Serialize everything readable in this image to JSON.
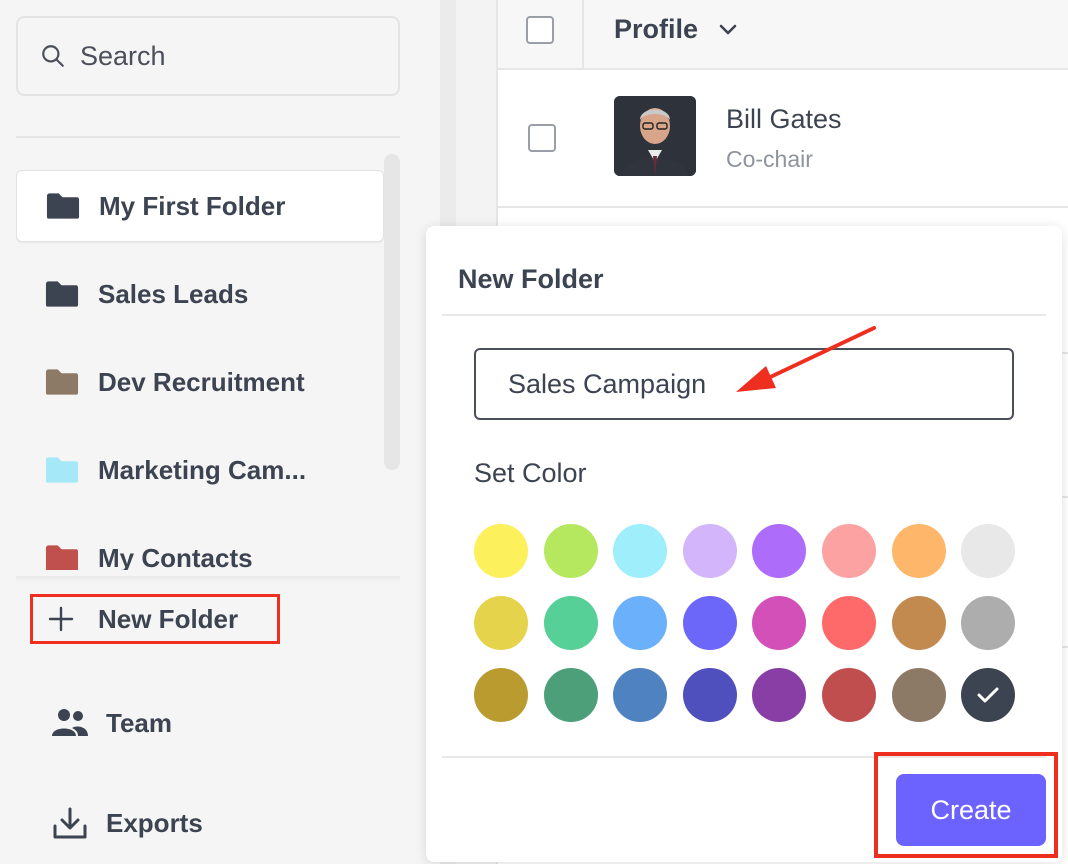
{
  "sidebar": {
    "search": {
      "placeholder": "Search",
      "icon": "search-icon"
    },
    "folders": [
      {
        "label": "My First Folder",
        "color": "#3d4451",
        "selected": true
      },
      {
        "label": "Sales Leads",
        "color": "#3d4451",
        "selected": false
      },
      {
        "label": "Dev Recruitment",
        "color": "#8c7a66",
        "selected": false
      },
      {
        "label": "Marketing Cam...",
        "color": "#a5e8f7",
        "selected": false
      },
      {
        "label": "My Contacts",
        "color": "#c0504d",
        "selected": false
      }
    ],
    "new_folder_label": "New Folder",
    "nav": [
      {
        "label": "Team",
        "icon": "team-icon"
      },
      {
        "label": "Exports",
        "icon": "download-icon"
      }
    ]
  },
  "table": {
    "header": {
      "column": "Profile"
    },
    "rows": [
      {
        "name": "Bill Gates",
        "role": "Co-chair"
      }
    ]
  },
  "modal": {
    "title": "New Folder",
    "input_value": "Sales Campaign",
    "color_label": "Set Color",
    "colors": [
      "#fdf05d",
      "#b5e85f",
      "#9eeefc",
      "#d3b5fb",
      "#ad6cf9",
      "#fda2a2",
      "#feb76a",
      "#e8e8e8",
      "#e5d34c",
      "#56d096",
      "#6ab0fb",
      "#6c67f9",
      "#d250b7",
      "#fe6969",
      "#c28a4f",
      "#adadad",
      "#b99b2f",
      "#4c9f79",
      "#4e82c1",
      "#4f4fbd",
      "#893ea6",
      "#c04e4e",
      "#8c7966",
      "#3d4451"
    ],
    "selected_color": "#3d4451",
    "create_label": "Create"
  },
  "colors": {
    "accent": "#6c63ff",
    "annotation": "#ee2e1e"
  }
}
